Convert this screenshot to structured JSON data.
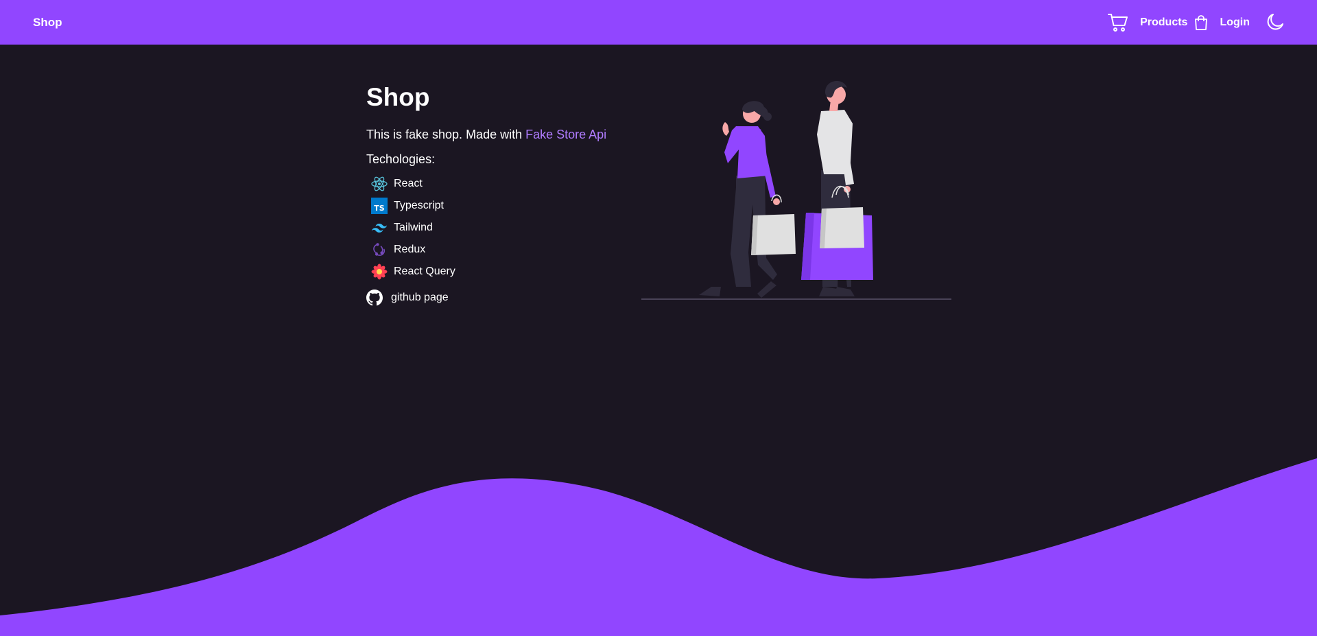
{
  "navbar": {
    "brand": "Shop",
    "products_label": "Products",
    "login_label": "Login",
    "icons": [
      "cart-icon",
      "shopping-bag-icon",
      "moon-icon"
    ],
    "background": "#9146ff"
  },
  "hero": {
    "title": "Shop",
    "description_prefix": "This is fake shop. Made with ",
    "api_link": "Fake Store Api",
    "technologies_heading": "Techologies:",
    "technologies": [
      {
        "label": "React",
        "icon": "react-icon",
        "color": "#58c4dc"
      },
      {
        "label": "Typescript",
        "icon": "typescript-icon",
        "color": "#007acc"
      },
      {
        "label": "Tailwind",
        "icon": "tailwind-icon",
        "color": "#38bdf8"
      },
      {
        "label": "Redux",
        "icon": "redux-icon",
        "color": "#764abc"
      },
      {
        "label": "React Query",
        "icon": "react-query-icon",
        "color": "#ff4154"
      }
    ],
    "github_label": "github page"
  },
  "colors": {
    "background": "#1b1622",
    "accent": "#9146ff",
    "link": "#b07cff"
  }
}
